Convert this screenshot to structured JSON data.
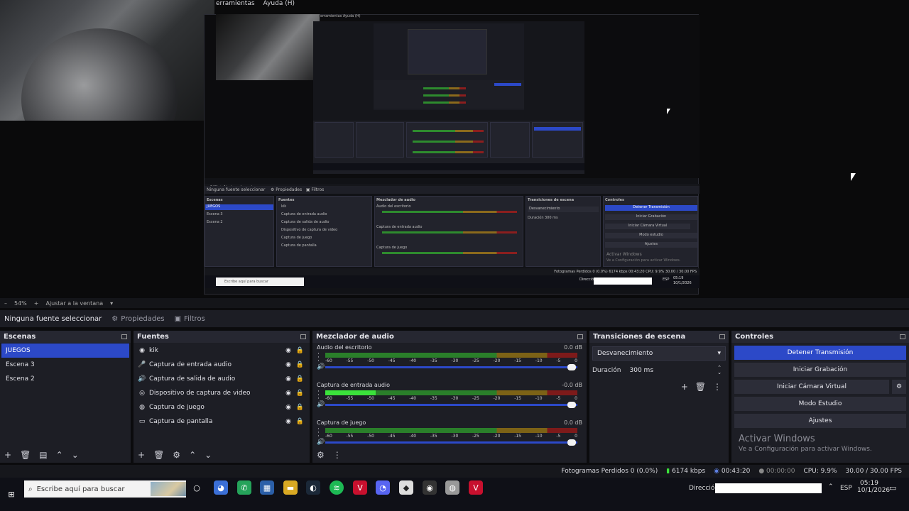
{
  "preview": {
    "menu_items": [
      "erramientas",
      "Ayuda (H)"
    ],
    "nested_menu": "erramientas    Ayuda (H)",
    "zoom_text": "54%",
    "fit_label": "Ajustar a la ventana"
  },
  "nested_ui": {
    "context_label": "Ninguna fuente seleccionar",
    "props_label": "Propiedades",
    "filters_label": "Filtros",
    "scenes_title": "Escenas",
    "scenes": [
      "JUEGOS",
      "Escena 3",
      "Escena 2"
    ],
    "sources_title": "Fuentes",
    "sources": [
      "kik",
      "Captura de entrada audio",
      "Captura de salida de audio",
      "Dispositivo de captura de video",
      "Captura de juego",
      "Captura de pantalla"
    ],
    "mixer_title": "Mezclador de audio",
    "mixer_channels": [
      "Audio del escritorio",
      "Captura de entrada audio",
      "Captura de juego"
    ],
    "transitions_title": "Transiciones de escena",
    "transition": "Desvanecimiento",
    "duration_label": "Duración",
    "duration": "300 ms",
    "controls_title": "Controles",
    "controls": [
      "Detener Transmisión",
      "Iniciar Grabación",
      "Iniciar Cámara Virtual",
      "Modo estudio",
      "Ajustes"
    ],
    "win_title": "Activar Windows",
    "win_sub": "Ve a Configuración para activar Windows.",
    "status": "Fotogramas Perdidos 0 (0.0%)   6174 kbps   00:43:20   CPU: 9.9%   30.00 / 30.00 FPS",
    "search_placeholder": "Escribe aquí para buscar",
    "direccion": "Dirección",
    "lang": "ESP",
    "time": "05:19",
    "date": "10/1/2026"
  },
  "context": {
    "no_source": "Ninguna fuente seleccionar",
    "properties": "Propiedades",
    "filters": "Filtros"
  },
  "scenes": {
    "title": "Escenas",
    "items": [
      {
        "label": "JUEGOS",
        "selected": true
      },
      {
        "label": "Escena 3"
      },
      {
        "label": "Escena 2"
      }
    ]
  },
  "sources": {
    "title": "Fuentes",
    "items": [
      {
        "label": "kik",
        "icon": "globe-icon",
        "glyph": "◉"
      },
      {
        "label": "Captura de entrada audio",
        "icon": "microphone-icon",
        "glyph": "🎤"
      },
      {
        "label": "Captura de salida de audio",
        "icon": "speaker-icon",
        "glyph": "🔊"
      },
      {
        "label": "Dispositivo de captura de video",
        "icon": "camera-icon",
        "glyph": "◎"
      },
      {
        "label": "Captura de juego",
        "icon": "gamepad-icon",
        "glyph": "◍"
      },
      {
        "label": "Captura de pantalla",
        "icon": "monitor-icon",
        "glyph": "▭"
      }
    ]
  },
  "mixer": {
    "title": "Mezclador de audio",
    "ticks": [
      "-60",
      "-55",
      "-50",
      "-45",
      "-40",
      "-35",
      "-30",
      "-25",
      "-20",
      "-15",
      "-10",
      "-5",
      "0"
    ],
    "channels": [
      {
        "name": "Audio del escritorio",
        "db": "0.0 dB",
        "level": 0
      },
      {
        "name": "Captura de entrada audio",
        "db": "-0.0 dB",
        "level": 0.2
      },
      {
        "name": "Captura de juego",
        "db": "0.0 dB",
        "level": 0
      }
    ]
  },
  "transitions": {
    "title": "Transiciones de escena",
    "selected": "Desvanecimiento",
    "duration_label": "Duración",
    "duration": "300 ms"
  },
  "controls": {
    "title": "Controles",
    "stop_stream": "Detener Transmisión",
    "start_record": "Iniciar Grabación",
    "start_vcam": "Iniciar Cámara Virtual",
    "studio_mode": "Modo Estudio",
    "settings": "Ajustes"
  },
  "watermark": {
    "title": "Activar Windows",
    "subtitle": "Ve a Configuración para activar Windows."
  },
  "status": {
    "dropped": "Fotogramas Perdidos 0 (0.0%)",
    "bitrate": "6174 kbps",
    "stream_time": "00:43:20",
    "rec_time": "00:00:00",
    "cpu": "CPU: 9.9%",
    "fps": "30.00 / 30.00 FPS"
  },
  "taskbar": {
    "search_placeholder": "Escribe aquí para buscar",
    "address_label": "Dirección",
    "lang": "ESP",
    "time": "05:19",
    "date": "10/1/2026"
  },
  "colors": {
    "accent": "#2c49c8",
    "meter_green": "#2a7f2a",
    "meter_yellow": "#7c6216",
    "meter_red": "#7d1a1a"
  }
}
